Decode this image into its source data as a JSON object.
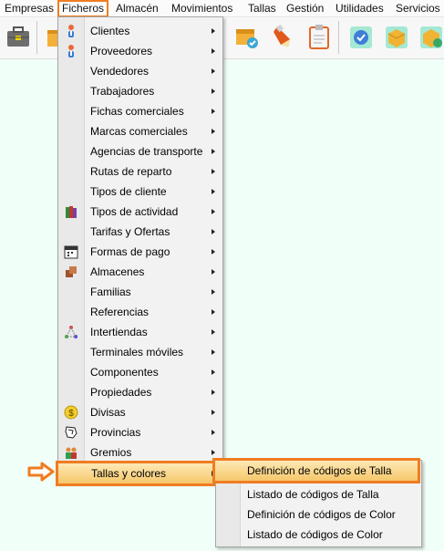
{
  "menubar": {
    "items": [
      "Empresas",
      "Ficheros",
      "Almacén",
      "Movimientos",
      "Tallas",
      "Gestión",
      "Utilidades",
      "Servicios"
    ]
  },
  "toolbar": {
    "icons": [
      "briefcase-icon",
      "box-icon",
      "box-check-icon",
      "pen-icon",
      "clipboard-icon",
      "check-circle-icon",
      "package-icon",
      "package-check-icon"
    ]
  },
  "ficheros_menu": {
    "items": [
      {
        "label": "Clientes",
        "icon": "person-icon"
      },
      {
        "label": "Proveedores",
        "icon": "person-icon"
      },
      {
        "label": "Vendedores",
        "icon": ""
      },
      {
        "label": "Trabajadores",
        "icon": ""
      },
      {
        "label": "Fichas comerciales",
        "icon": ""
      },
      {
        "label": "Marcas comerciales",
        "icon": ""
      },
      {
        "label": "Agencias de transporte",
        "icon": ""
      },
      {
        "label": "Rutas de reparto",
        "icon": ""
      },
      {
        "label": "Tipos de cliente",
        "icon": ""
      },
      {
        "label": "Tipos de actividad",
        "icon": "books-icon"
      },
      {
        "label": "Tarifas y Ofertas",
        "icon": ""
      },
      {
        "label": "Formas de pago",
        "icon": "calendar-icon"
      },
      {
        "label": "Almacenes",
        "icon": "boxes-icon"
      },
      {
        "label": "Familias",
        "icon": ""
      },
      {
        "label": "Referencias",
        "icon": ""
      },
      {
        "label": "Intertiendas",
        "icon": "network-icon"
      },
      {
        "label": "Terminales móviles",
        "icon": ""
      },
      {
        "label": "Componentes",
        "icon": ""
      },
      {
        "label": "Propiedades",
        "icon": ""
      },
      {
        "label": "Divisas",
        "icon": "coin-icon"
      },
      {
        "label": "Provincias",
        "icon": "map-icon"
      },
      {
        "label": "Gremios",
        "icon": "group-icon"
      }
    ],
    "highlighted": "Tallas y colores"
  },
  "submenu": {
    "highlighted": "Definición de códigos de Talla",
    "items": [
      "Listado de códigos de Talla",
      "Definición de códigos de Color",
      "Listado de códigos de Color"
    ]
  },
  "colors": {
    "accent": "#ef7d22",
    "background": "#f0fff7",
    "highlight": "#f6c76a"
  }
}
